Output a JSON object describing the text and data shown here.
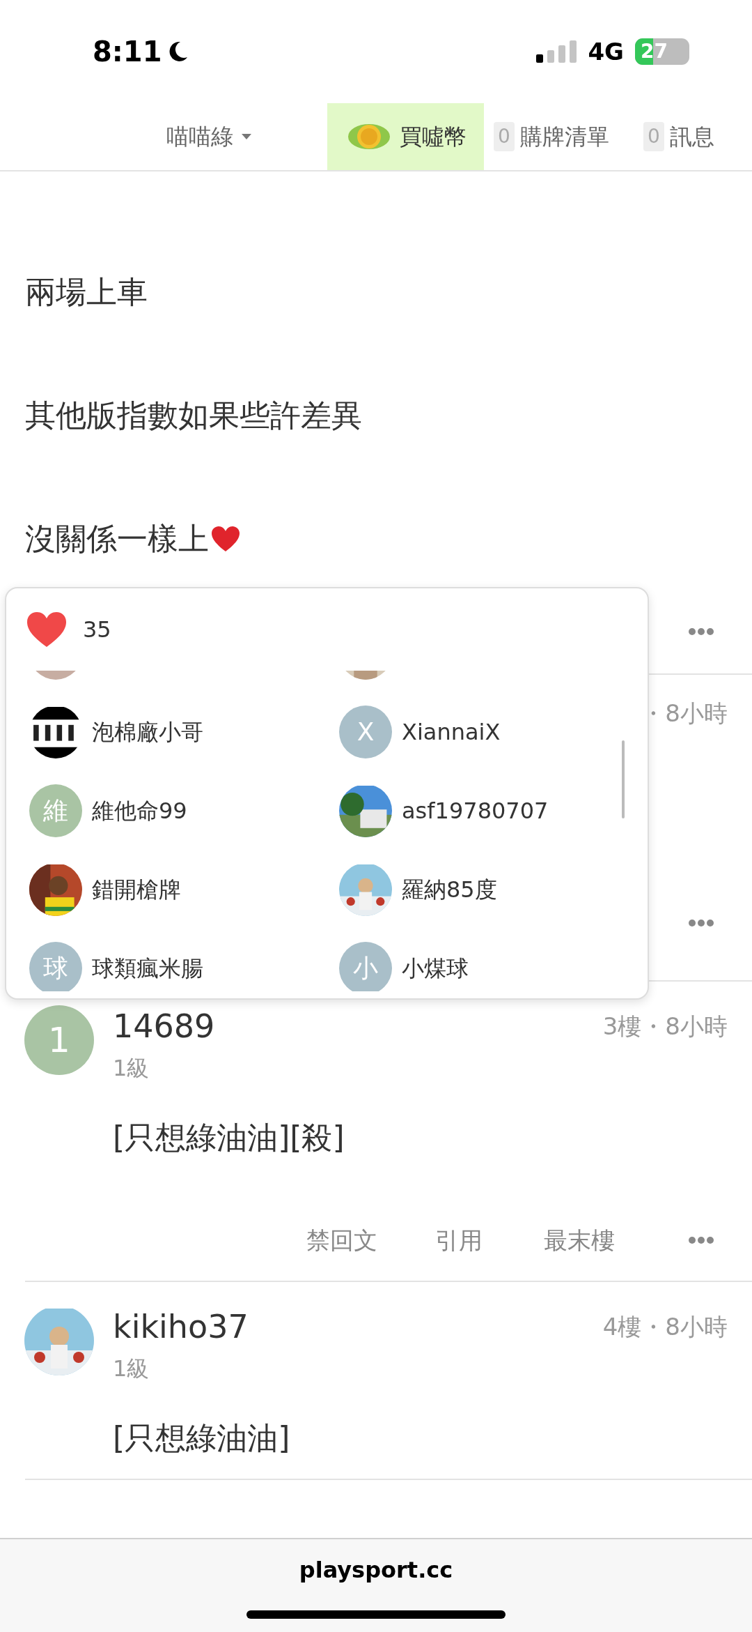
{
  "status_bar": {
    "time": "8:11",
    "network": "4G",
    "battery": "27"
  },
  "nav": {
    "user": "喵喵綠",
    "items": [
      {
        "kind": "coin",
        "label": "買噓幣"
      },
      {
        "kind": "count",
        "count": "0",
        "label": "購牌清單"
      },
      {
        "kind": "count",
        "count": "0",
        "label": "訊息"
      }
    ]
  },
  "first_post": {
    "lines": [
      {
        "kind": "plain",
        "text": "兩場上車"
      },
      {
        "kind": "plain",
        "text": "其他版指數如果些許差異"
      },
      {
        "kind": "with_heart",
        "text": "沒關係一樣上"
      }
    ]
  },
  "posts": [
    {
      "meta": "・8小時"
    },
    {
      "avatar": {
        "kind": "letter",
        "letter": "1",
        "color": "#a9c4a4"
      },
      "name": "14689",
      "level": "1級",
      "meta": "3樓・8小時",
      "body": "[只想綠油油][殺]",
      "actions": [
        "禁回文",
        "引用",
        "最末樓"
      ]
    },
    {
      "avatar": {
        "kind": "picture"
      },
      "name": "kikiho37",
      "level": "1級",
      "meta": "4樓・8小時",
      "body": "[只想綠油油]"
    }
  ],
  "likes_popup": {
    "count": "35",
    "users": [
      {
        "avatar": {
          "kind": "letter",
          "color": "#c7ada2"
        }
      },
      {
        "avatar": {
          "kind": "picture"
        }
      },
      {
        "avatar": {
          "kind": "picture"
        },
        "name": "泡棉廠小哥"
      },
      {
        "avatar": {
          "kind": "letter",
          "letter": "X",
          "color": "#a9bfc9"
        },
        "name": "XiannaiX"
      },
      {
        "avatar": {
          "kind": "letter",
          "letter": "維",
          "color": "#a9c4a4"
        },
        "name": "維他命99"
      },
      {
        "avatar": {
          "kind": "picture"
        },
        "name": "asf19780707"
      },
      {
        "avatar": {
          "kind": "picture"
        },
        "name": "錯開槍牌"
      },
      {
        "avatar": {
          "kind": "picture"
        },
        "name": "羅納85度"
      },
      {
        "avatar": {
          "kind": "letter",
          "letter": "球",
          "color": "#a9bfc9"
        },
        "name": "球類瘋米腸"
      },
      {
        "avatar": {
          "kind": "letter",
          "letter": "小",
          "color": "#a9bfc9"
        },
        "name": "小煤球"
      }
    ]
  },
  "footer": {
    "url": "playsport.cc"
  }
}
